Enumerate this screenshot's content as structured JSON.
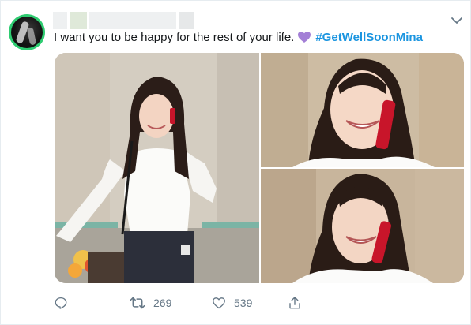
{
  "tweet": {
    "author_name": "",
    "text": "I want you to be happy for the rest of your life.",
    "emoji": "💜",
    "hashtag": "#GetWellSoonMina",
    "accent_color": "#1b95e0",
    "avatar_ring_color": "#2ecc71",
    "emoji_color": "#a37fd6"
  },
  "media": {
    "photos": [
      {
        "name": "photo-1",
        "description": "woman in white sweater on phone, full body"
      },
      {
        "name": "photo-2",
        "description": "woman smiling on red phone, close-up"
      },
      {
        "name": "photo-3",
        "description": "woman smiling on red phone, close-up"
      }
    ]
  },
  "actions": {
    "reply_icon": "reply-icon",
    "retweet_icon": "retweet-icon",
    "retweet_count": "269",
    "like_icon": "heart-icon",
    "like_count": "539",
    "share_icon": "share-icon"
  },
  "menu_icon": "chevron-down-icon"
}
